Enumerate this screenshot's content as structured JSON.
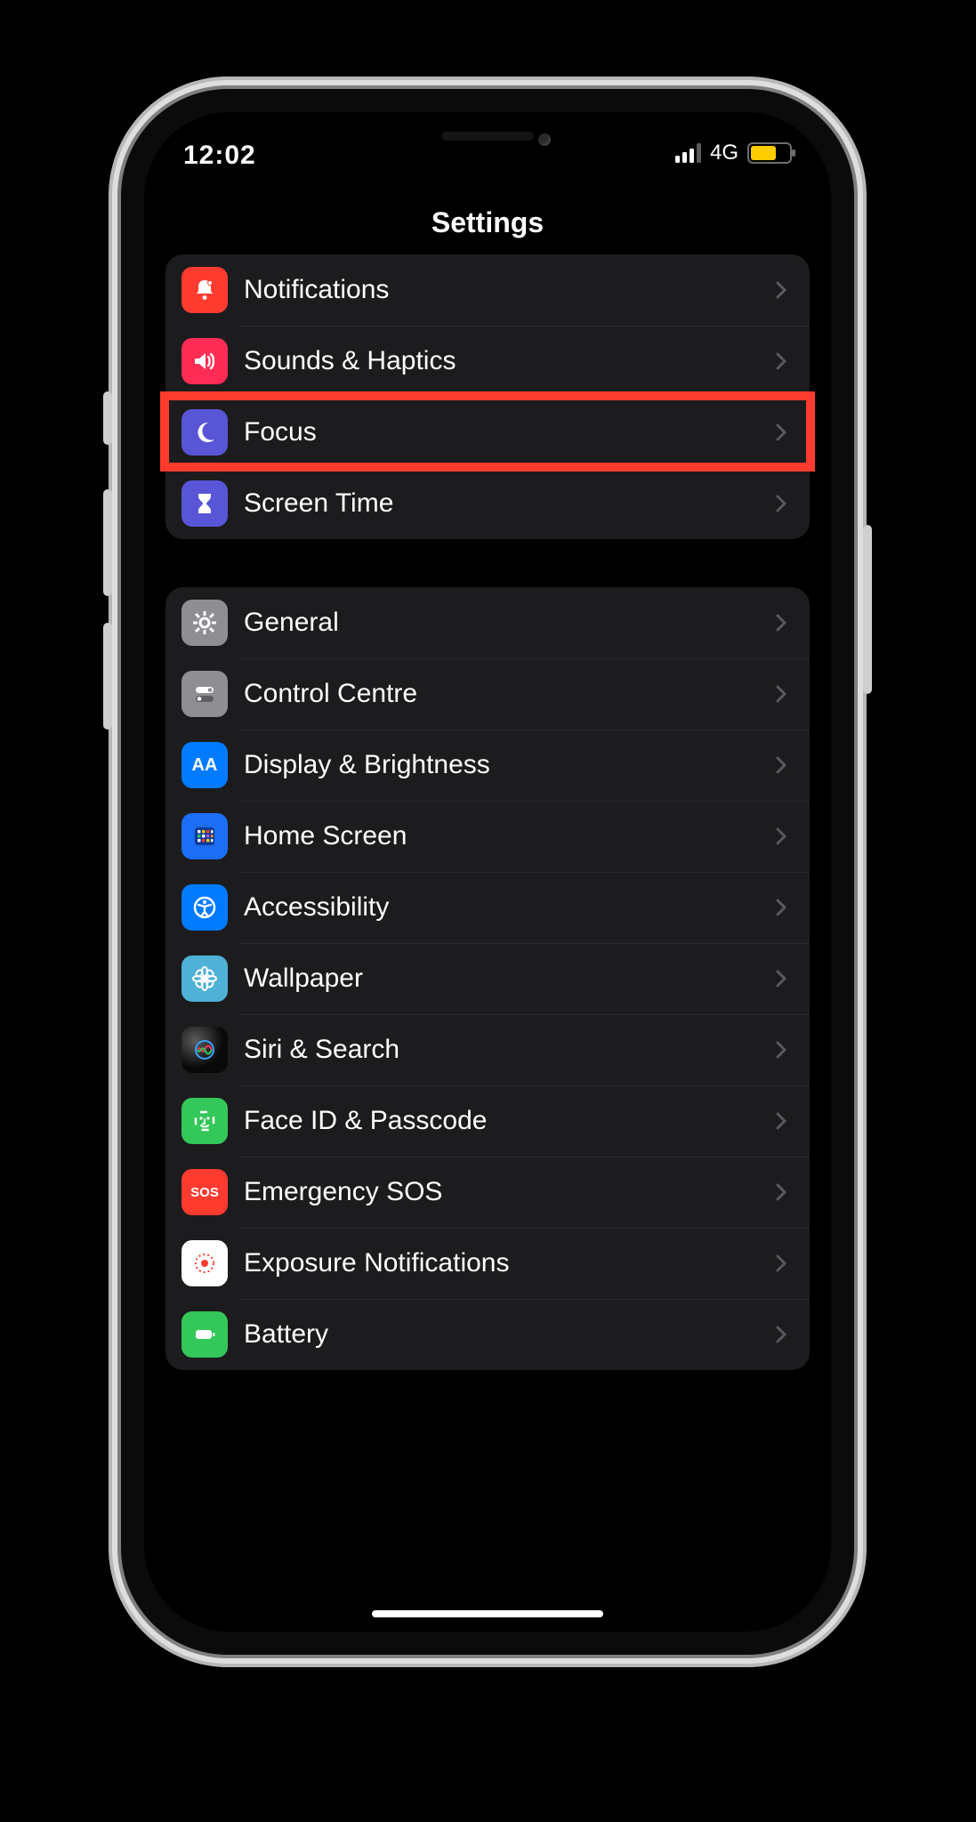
{
  "status": {
    "time": "12:02",
    "network": "4G"
  },
  "nav": {
    "title": "Settings"
  },
  "groups": [
    {
      "rows": [
        {
          "id": "notifications",
          "label": "Notifications",
          "icon": "bell",
          "bg": "bg-red",
          "highlighted": false
        },
        {
          "id": "sounds",
          "label": "Sounds & Haptics",
          "icon": "speaker",
          "bg": "bg-pink",
          "highlighted": false
        },
        {
          "id": "focus",
          "label": "Focus",
          "icon": "moon",
          "bg": "bg-indigo",
          "highlighted": true
        },
        {
          "id": "screentime",
          "label": "Screen Time",
          "icon": "hourglass",
          "bg": "bg-indigo",
          "highlighted": false
        }
      ]
    },
    {
      "rows": [
        {
          "id": "general",
          "label": "General",
          "icon": "gear",
          "bg": "bg-gray",
          "highlighted": false
        },
        {
          "id": "controlcentre",
          "label": "Control Centre",
          "icon": "toggles",
          "bg": "bg-gray",
          "highlighted": false
        },
        {
          "id": "display",
          "label": "Display & Brightness",
          "icon": "aa",
          "bg": "bg-blue",
          "highlighted": false
        },
        {
          "id": "homescreen",
          "label": "Home Screen",
          "icon": "grid",
          "bg": "bg-hblue",
          "highlighted": false
        },
        {
          "id": "accessibility",
          "label": "Accessibility",
          "icon": "accessibility",
          "bg": "bg-blue",
          "highlighted": false
        },
        {
          "id": "wallpaper",
          "label": "Wallpaper",
          "icon": "flower",
          "bg": "bg-cyan",
          "highlighted": false
        },
        {
          "id": "siri",
          "label": "Siri & Search",
          "icon": "siri",
          "bg": "bg-siri",
          "highlighted": false
        },
        {
          "id": "faceid",
          "label": "Face ID & Passcode",
          "icon": "faceid",
          "bg": "bg-green",
          "highlighted": false
        },
        {
          "id": "sos",
          "label": "Emergency SOS",
          "icon": "sos",
          "bg": "bg-red",
          "highlighted": false
        },
        {
          "id": "exposure",
          "label": "Exposure Notifications",
          "icon": "exposure",
          "bg": "bg-white",
          "highlighted": false
        },
        {
          "id": "battery",
          "label": "Battery",
          "icon": "battery",
          "bg": "bg-green",
          "highlighted": false
        }
      ]
    }
  ]
}
